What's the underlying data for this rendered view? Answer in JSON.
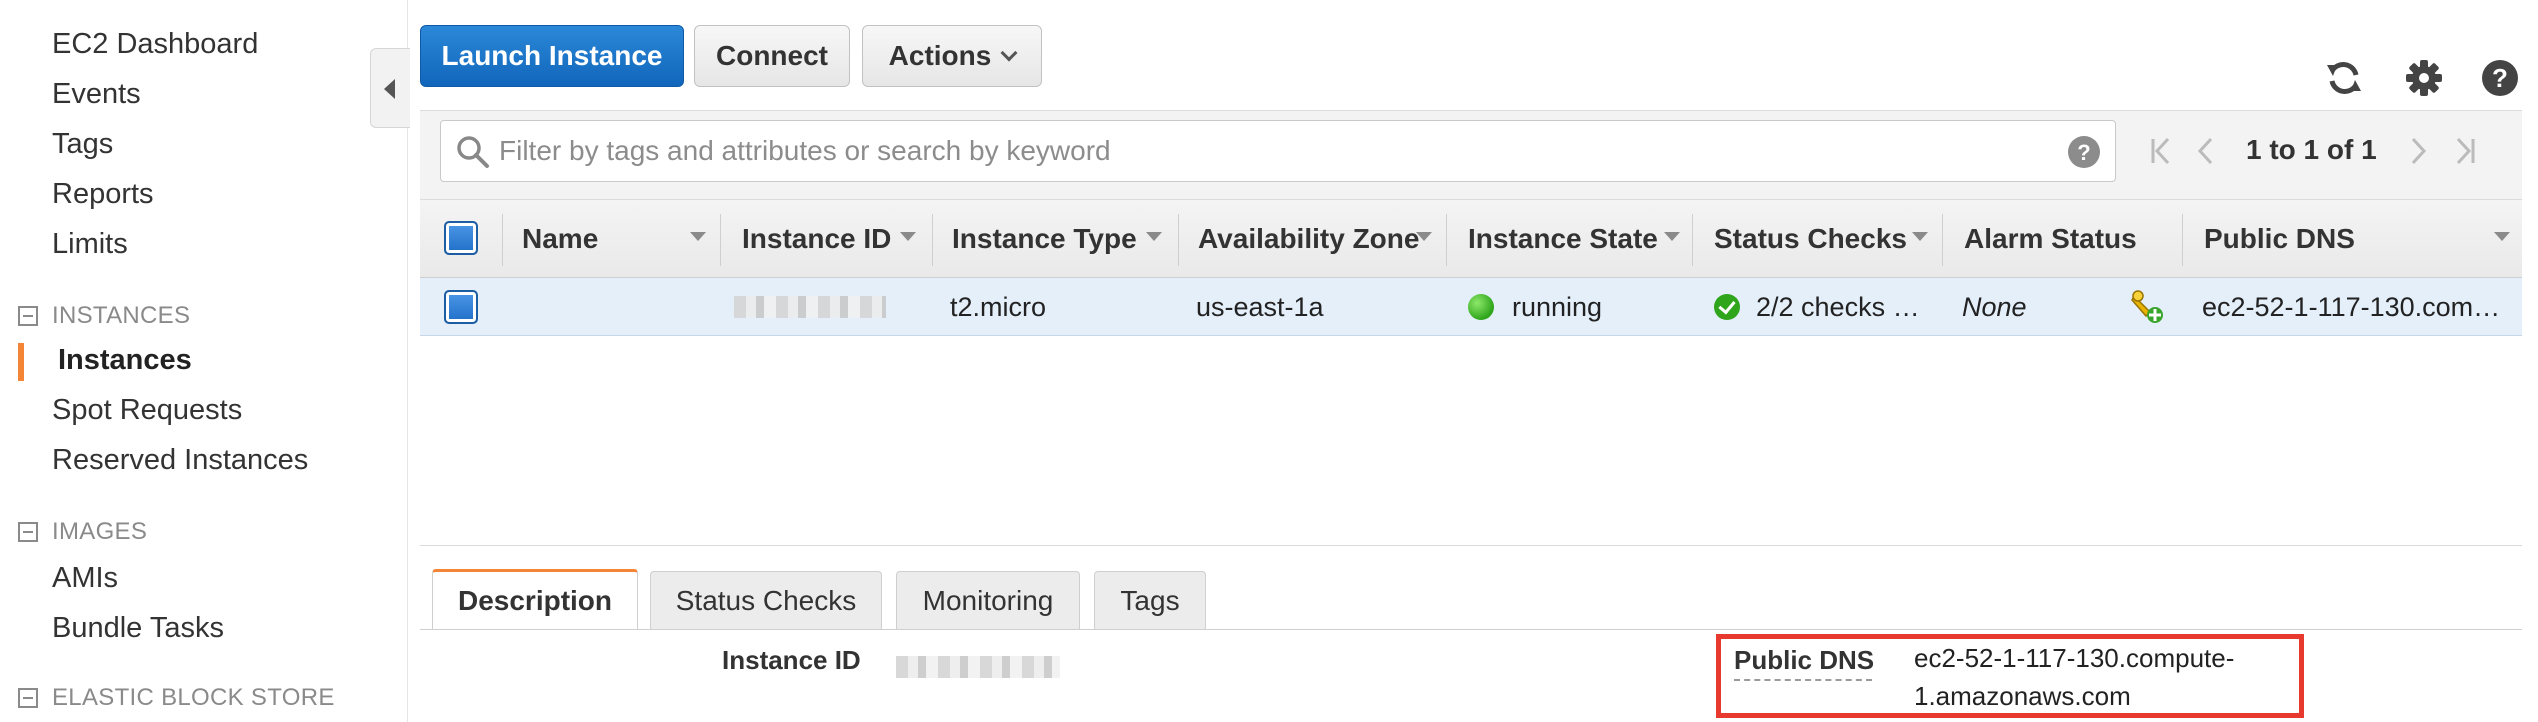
{
  "sidebar": {
    "items": [
      {
        "label": "EC2 Dashboard"
      },
      {
        "label": "Events"
      },
      {
        "label": "Tags"
      },
      {
        "label": "Reports"
      },
      {
        "label": "Limits"
      }
    ],
    "sections": [
      {
        "title": "INSTANCES",
        "items": [
          "Instances",
          "Spot Requests",
          "Reserved Instances"
        ]
      },
      {
        "title": "IMAGES",
        "items": [
          "AMIs",
          "Bundle Tasks"
        ]
      },
      {
        "title": "ELASTIC BLOCK STORE",
        "items": []
      }
    ],
    "active_item": "Instances"
  },
  "toolbar": {
    "launch_label": "Launch Instance",
    "connect_label": "Connect",
    "actions_label": "Actions",
    "icons": [
      "refresh-icon",
      "gear-icon",
      "help-icon"
    ]
  },
  "filter": {
    "placeholder": "Filter by tags and attributes or search by keyword",
    "value": ""
  },
  "pager": {
    "text": "1 to 1 of 1"
  },
  "table": {
    "columns": [
      "Name",
      "Instance ID",
      "Instance Type",
      "Availability Zone",
      "Instance State",
      "Status Checks",
      "Alarm Status",
      "Public DNS"
    ],
    "rows": [
      {
        "name": "",
        "instance_id": "",
        "instance_type": "t2.micro",
        "availability_zone": "us-east-1a",
        "instance_state": "running",
        "status_checks": "2/2 checks …",
        "alarm_status": "None",
        "public_dns": "ec2-52-1-117-130.com…"
      }
    ]
  },
  "detail_tabs": [
    "Description",
    "Status Checks",
    "Monitoring",
    "Tags"
  ],
  "details": {
    "instance_id_label": "Instance ID",
    "instance_id_value": "",
    "public_dns_label": "Public DNS",
    "public_dns_line1": "ec2-52-1-117-130.compute-",
    "public_dns_line2": "1.amazonaws.com"
  },
  "colors": {
    "primary_button": "#1a73c9",
    "active_accent": "#f58536",
    "selected_row": "#e4effa",
    "running_green": "#2ea51b",
    "highlight_red": "#e8392f"
  }
}
